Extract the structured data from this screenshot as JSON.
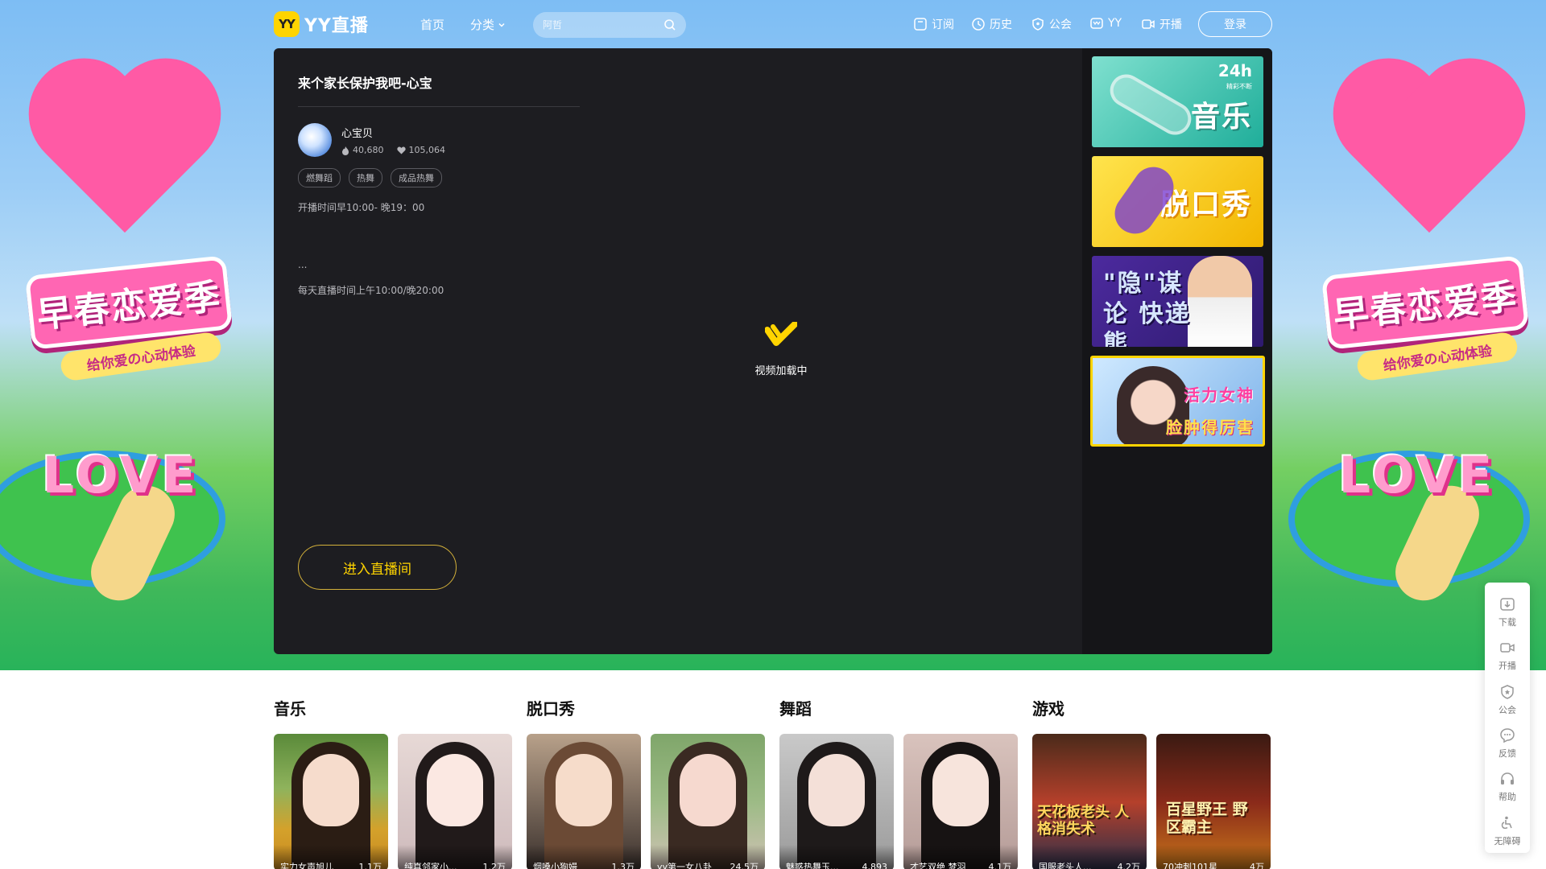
{
  "nav": {
    "logo_badge": "YY",
    "logo_text": "YY直播",
    "home": "首页",
    "category": "分类",
    "search_placeholder": "阿哲",
    "subscribe": "订阅",
    "history": "历史",
    "guild": "公会",
    "yy": "YY",
    "broadcast": "开播",
    "login": "登录"
  },
  "background": {
    "banner_text": "早春恋爱季",
    "banner_subtext": "给你爱の心动体验",
    "love_text": "LOVE"
  },
  "room": {
    "title": "来个家长保护我吧-心宝",
    "anchor_name": "心宝贝",
    "heat": "40,680",
    "fans": "105,064",
    "tags": [
      "燃舞蹈",
      "热舞",
      "成品热舞"
    ],
    "schedule": "开播时间早10:00- 晚19：00",
    "ellipsis": "...",
    "schedule2": "每天直播时间上午10:00/晚20:00",
    "enter_button": "进入直播间",
    "loading_text": "视频加载中"
  },
  "sidebar_thumbs": [
    {
      "text": "音乐",
      "badge": "24h",
      "badge_sub": "精彩不断"
    },
    {
      "text": "脱口秀"
    },
    {
      "text": "\"隐\"谋论 快递熊"
    },
    {
      "text1": "活力女神",
      "text2": "脸肿得厉害"
    }
  ],
  "sections": [
    {
      "title": "音乐",
      "cards": [
        {
          "name": "实力女声旭儿",
          "count": "1.1万"
        },
        {
          "name": "纯真邻家小...",
          "count": "1.2万"
        }
      ]
    },
    {
      "title": "脱口秀",
      "cards": [
        {
          "name": "烟嗓小狗嫚",
          "count": "1.3万"
        },
        {
          "name": "yy第一女八卦",
          "count": "24.5万"
        }
      ]
    },
    {
      "title": "舞蹈",
      "cards": [
        {
          "name": "魅惑热舞玉...",
          "count": "4,893"
        },
        {
          "name": "才艺双绝 梦羽",
          "count": "4.1万"
        }
      ]
    },
    {
      "title": "游戏",
      "cards": [
        {
          "name": "国服老头人...",
          "count": "4.2万"
        },
        {
          "name": "70冲刺101星",
          "count": "4万"
        }
      ]
    }
  ],
  "card_images": [
    {
      "label": ""
    },
    {
      "label": ""
    },
    {
      "label": ""
    },
    {
      "label": ""
    },
    {
      "label": ""
    },
    {
      "label": ""
    },
    {
      "label": "天花板老头 人格消失术"
    },
    {
      "label": "百星野王 野区霸主"
    }
  ],
  "float_bar": [
    "下载",
    "开播",
    "公会",
    "反馈",
    "帮助",
    "无障碍"
  ],
  "colors": {
    "accent": "#ffd400",
    "player_bg": "#1d1d21",
    "sidebar_bg": "#151518"
  }
}
